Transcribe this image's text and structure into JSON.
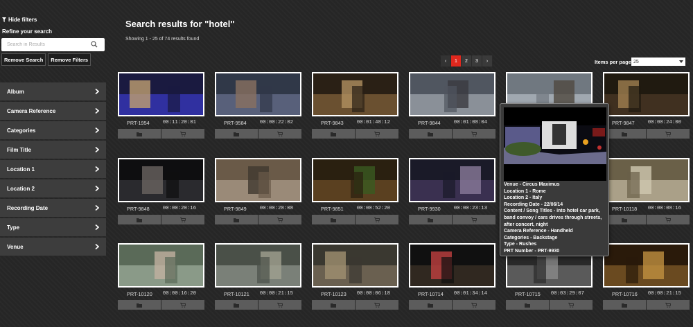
{
  "sidebar": {
    "hide_filters": "Hide filters",
    "refine": "Refine your search",
    "search_placeholder": "Search in Results",
    "remove_search": "Remove Search",
    "remove_filters": "Remove Filters",
    "filters": [
      "Album",
      "Camera Reference",
      "Categories",
      "Film Title",
      "Location 1",
      "Location 2",
      "Recording Date",
      "Type",
      "Venue"
    ]
  },
  "main": {
    "title": "Search results for \"hotel\"",
    "showing": "Showing 1 - 25 of 74 results found",
    "pagination": {
      "prev": "‹",
      "pages": [
        "1",
        "2",
        "3"
      ],
      "active": "1",
      "next": "›"
    },
    "items_per_page_label": "Items per page",
    "items_per_page_value": "25"
  },
  "results": [
    {
      "id": "PRT-1954",
      "duration": "00:11:20:01"
    },
    {
      "id": "PRT-9584",
      "duration": "00:00:22:02"
    },
    {
      "id": "PRT-9843",
      "duration": "00:01:48:12"
    },
    {
      "id": "PRT-9844",
      "duration": "00:01:08:04"
    },
    {
      "id": "",
      "duration": ""
    },
    {
      "id": "PRT-9847",
      "duration": "00:00:24:00"
    },
    {
      "id": "PRT-9848",
      "duration": "00:00:20:16"
    },
    {
      "id": "PRT-9849",
      "duration": "00:00:28:08"
    },
    {
      "id": "PRT-9851",
      "duration": "00:00:52:20"
    },
    {
      "id": "PRT-9930",
      "duration": "00:00:23:13"
    },
    {
      "id": "",
      "duration": ""
    },
    {
      "id": "PRT-10118",
      "duration": "00:00:08:16"
    },
    {
      "id": "PRT-10120",
      "duration": "00:00:16:20"
    },
    {
      "id": "PRT-10121",
      "duration": "00:00:21:15"
    },
    {
      "id": "PRT-10123",
      "duration": "00:00:06:18"
    },
    {
      "id": "PRT-10714",
      "duration": "00:01:34:14"
    },
    {
      "id": "PRT-10715",
      "duration": "00:03:29:07"
    },
    {
      "id": "PRT-10716",
      "duration": "00:00:21:15"
    }
  ],
  "tooltip": {
    "lines": [
      "Venue - Circus Maximus",
      "Location 1 - Rome",
      "Location 2 - Italy",
      "Recording Date - 22/06/14",
      "Content / Song Titles - into hotel car park, band convoy / cars drives through streets, after concert, night",
      "Camera Reference - Handheld",
      "Categories - Backstage",
      "Type - Rushes",
      "PRT Number - PRT-9930"
    ]
  },
  "colors": {
    "accent": "#e0281e",
    "background": "#262626",
    "filter_bg": "#3d3d3d",
    "action_bg": "#5c5c5c"
  }
}
